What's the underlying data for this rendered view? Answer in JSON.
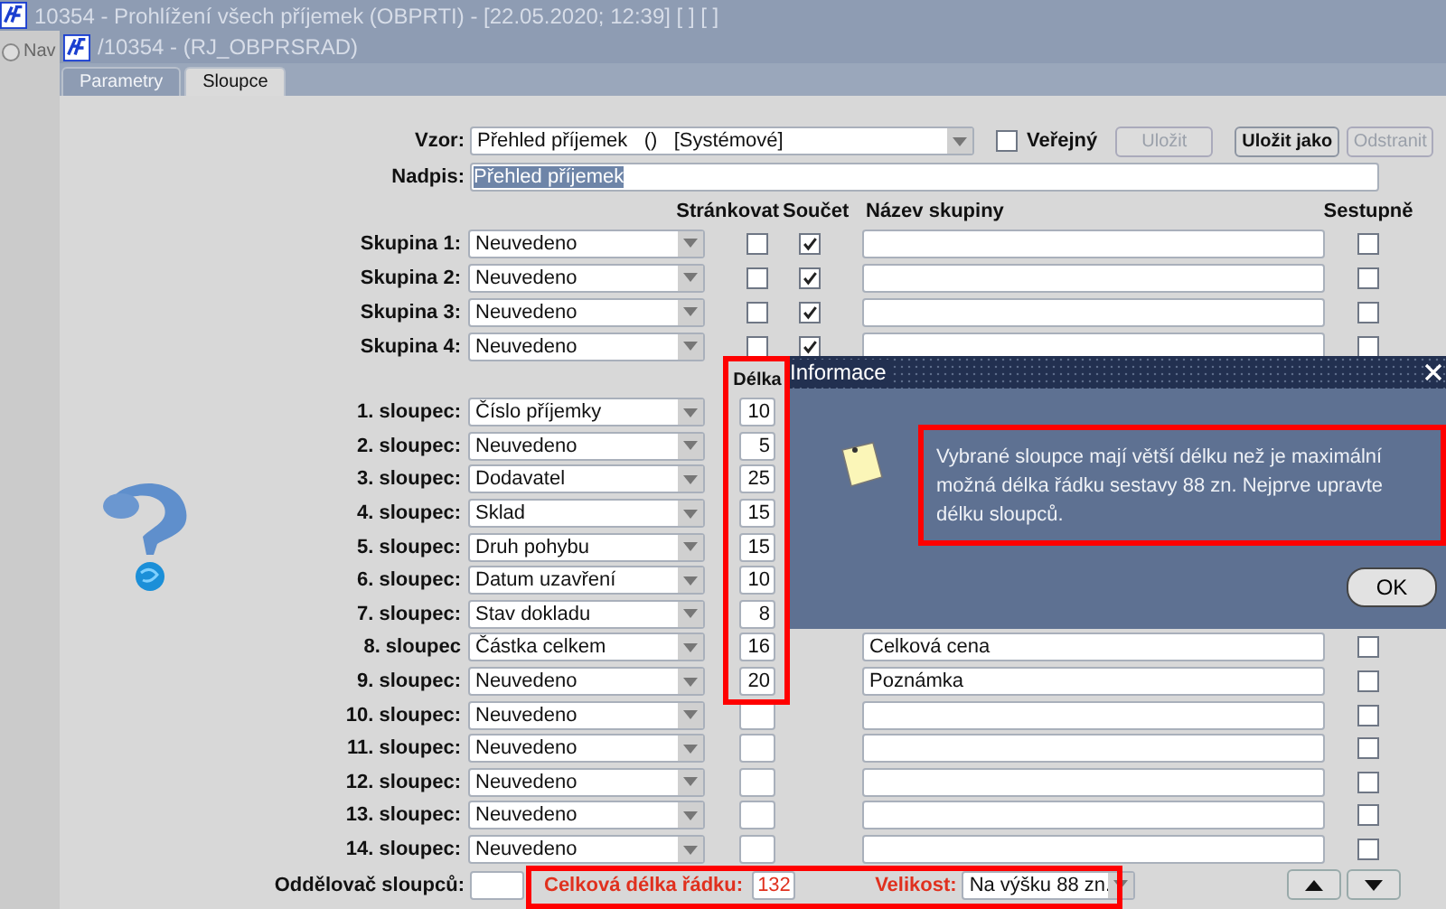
{
  "app_title": "10354 - Prohlížení všech příjemek (OBPRTI) - [22.05.2020; 12:39] [ ] [ ]",
  "nav": "Nav",
  "window_title": "/10354 - (RJ_OBPRSRAD)",
  "tabs": [
    {
      "label": "Parametry",
      "selected": false
    },
    {
      "label": "Sloupce",
      "selected": true
    }
  ],
  "template": {
    "label": "Vzor:",
    "value": "Přehled příjemek   ()   [Systémové]"
  },
  "public": {
    "label": "Veřejný",
    "checked": false
  },
  "buttons": [
    {
      "label": "Uložit",
      "disabled": true
    },
    {
      "label": "Uložit jako",
      "disabled": false
    },
    {
      "label": "Odstranit",
      "disabled": true
    }
  ],
  "heading": {
    "label": "Nadpis:",
    "value": "Přehled příjemek",
    "value_selected": true
  },
  "group_headers": [
    "Stránkovat",
    "Součet",
    "Název skupiny",
    "Sestupně"
  ],
  "groups": [
    {
      "label": "Skupina 1:",
      "value": "Neuvedeno",
      "paging": false,
      "sum": true,
      "descending": false
    },
    {
      "label": "Skupina 2:",
      "value": "Neuvedeno",
      "paging": false,
      "sum": true,
      "descending": false
    },
    {
      "label": "Skupina 3:",
      "value": "Neuvedeno",
      "paging": false,
      "sum": true,
      "descending": false
    },
    {
      "label": "Skupina 4:",
      "value": "Neuvedeno",
      "paging": false,
      "sum": true,
      "descending": false
    }
  ],
  "length_header": "Délka",
  "columns": [
    {
      "label": "1. sloupec:",
      "value": "Číslo příjemky",
      "length": "10"
    },
    {
      "label": "2. sloupec:",
      "value": "Neuvedeno",
      "length": "5"
    },
    {
      "label": "3. sloupec:",
      "value": "Dodavatel",
      "length": "25"
    },
    {
      "label": "4. sloupec:",
      "value": "Sklad",
      "length": "15"
    },
    {
      "label": "5. sloupec:",
      "value": "Druh pohybu",
      "length": "15"
    },
    {
      "label": "6. sloupec:",
      "value": "Datum uzavření",
      "length": "10"
    },
    {
      "label": "7. sloupec:",
      "value": "Stav dokladu",
      "length": "8"
    },
    {
      "label": "8. sloupec",
      "value": "Částka celkem",
      "length": "16",
      "name": "Celková cena",
      "descending": false
    },
    {
      "label": "9. sloupec:",
      "value": "Neuvedeno",
      "length": "20",
      "name": "Poznámka",
      "descending": false
    },
    {
      "label": "10. sloupec:",
      "value": "Neuvedeno",
      "descending": false
    },
    {
      "label": "11. sloupec:",
      "value": "Neuvedeno",
      "descending": false
    },
    {
      "label": "12. sloupec:",
      "value": "Neuvedeno",
      "descending": false
    },
    {
      "label": "13. sloupec:",
      "value": "Neuvedeno",
      "descending": false
    },
    {
      "label": "14. sloupec:",
      "value": "Neuvedeno",
      "descending": false
    }
  ],
  "separator": {
    "label": "Oddělovač sloupců:"
  },
  "total_length": {
    "label": "Celková délka řádku:",
    "value": "132"
  },
  "size": {
    "label": "Velikost:",
    "value": "Na výšku 88 zn."
  },
  "dialog": {
    "title": "Informace",
    "message": "Vybrané sloupce mají větší délku než je maximální možná délka řádku sestavy 88 zn. Nejprve upravte délku sloupců.",
    "button": "OK"
  }
}
